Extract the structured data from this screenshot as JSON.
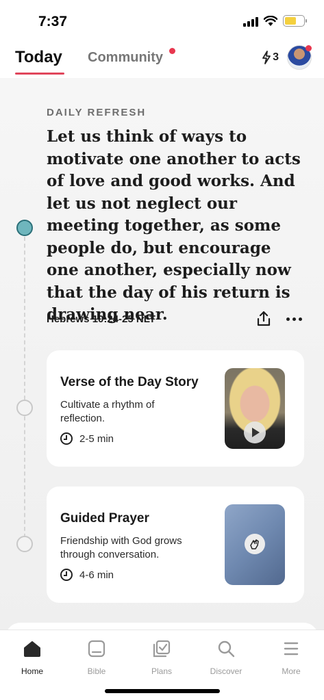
{
  "status_bar": {
    "time": "7:37"
  },
  "top_nav": {
    "tabs": [
      {
        "label": "Today",
        "active": true
      },
      {
        "label": "Community",
        "active": false,
        "has_notification": true
      }
    ],
    "streak_count": "3",
    "avatar_has_notification": true
  },
  "daily_refresh": {
    "label": "DAILY REFRESH",
    "verse": "Let us think of ways to motivate one another to acts of love and good works. And let us not neglect our meeting together, as some people do, but encourage one another, especially now that the day of his return is drawing near.",
    "reference": "Hebrews 10:24-25 NLT"
  },
  "cards": [
    {
      "title": "Verse of the Day Story",
      "description": "Cultivate a rhythm of reflection.",
      "duration": "2-5 min"
    },
    {
      "title": "Guided Prayer",
      "description": "Friendship with God grows through conversation.",
      "duration": "4-6 min"
    }
  ],
  "bottom_nav": {
    "items": [
      {
        "label": "Home",
        "icon": "home-icon",
        "active": true
      },
      {
        "label": "Bible",
        "icon": "bible-icon",
        "active": false
      },
      {
        "label": "Plans",
        "icon": "plans-icon",
        "active": false
      },
      {
        "label": "Discover",
        "icon": "search-icon",
        "active": false
      },
      {
        "label": "More",
        "icon": "menu-icon",
        "active": false
      }
    ]
  },
  "colors": {
    "accent": "#e0455b",
    "timeline_active": "#6fb6bd",
    "notification": "#e8374f"
  }
}
